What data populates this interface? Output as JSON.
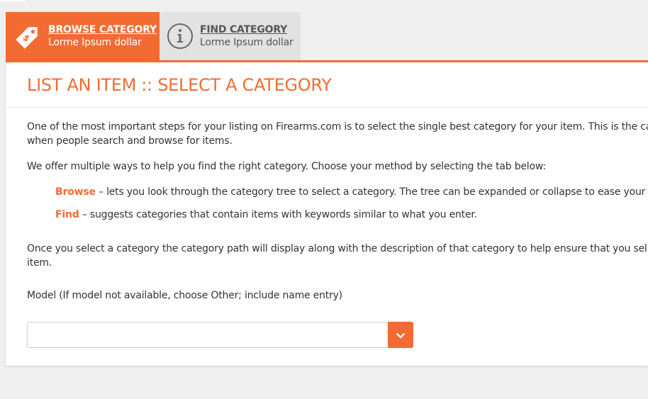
{
  "tabs": {
    "browse": {
      "title": "BROWSE CATEGORY",
      "subtitle": "Lorme Ipsum dollar",
      "icon": "price-tag-icon"
    },
    "find": {
      "title": "FIND CATEGORY",
      "subtitle": "Lorme Ipsum dollar",
      "icon": "info-icon"
    }
  },
  "page": {
    "title": "LIST AN ITEM :: SELECT A CATEGORY",
    "intro_line1": "One of the most important steps for your listing on Firearms.com is to select the single best category for your item. This is the ca",
    "intro_line2": "when people search and browse for items.",
    "methods_intro": "We offer multiple ways to help you find the right category. Choose your method by selecting the tab below:",
    "browse_label": "Browse",
    "browse_desc": " – lets you look through the category tree to select a category. The tree can be expanded or collapse to ease your v",
    "find_label": "Find",
    "find_desc": " – suggests categories that contain items with keywords similar to what you enter.",
    "outro_line1": "Once you select a category the category path will display along with the description of that category to help ensure that you sel",
    "outro_line2": "item.",
    "model_label": "Model (If model not available, choose Other; include name entry)",
    "model_value": ""
  },
  "colors": {
    "accent": "#f26b32",
    "tab_inactive": "#e2e2e2",
    "background": "#efefef"
  }
}
